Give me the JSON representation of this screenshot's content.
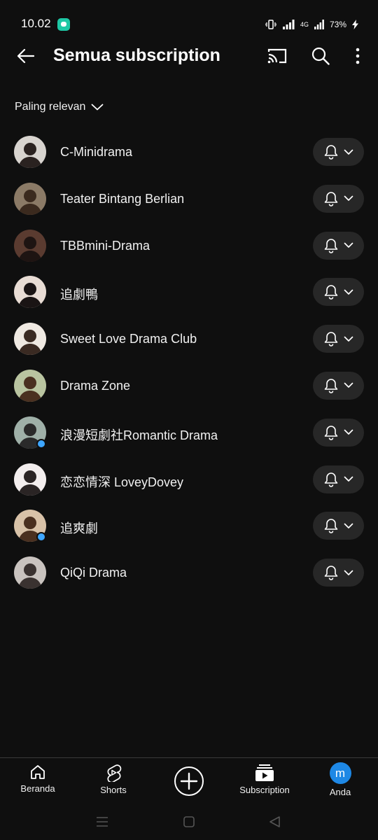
{
  "status_bar": {
    "time": "10.02",
    "network": "4G",
    "battery": "73%"
  },
  "header": {
    "title": "Semua subscription",
    "icons": [
      "back-arrow-icon",
      "cast-icon",
      "search-icon",
      "more-vert-icon"
    ]
  },
  "sort": {
    "label": "Paling relevan"
  },
  "channels": [
    {
      "name": "C-Minidrama",
      "has_new": false,
      "avatar_bg": "#d8d4cf",
      "avatar_fg": "#2a2220"
    },
    {
      "name": "Teater Bintang Berlian",
      "has_new": false,
      "avatar_bg": "#8b7a66",
      "avatar_fg": "#3b2a1e"
    },
    {
      "name": "TBBmini-Drama",
      "has_new": false,
      "avatar_bg": "#5a3b30",
      "avatar_fg": "#1e1412"
    },
    {
      "name": "追劇鴨",
      "has_new": false,
      "avatar_bg": "#e8dcd4",
      "avatar_fg": "#1a1414"
    },
    {
      "name": "Sweet Love Drama Club",
      "has_new": false,
      "avatar_bg": "#efe9e2",
      "avatar_fg": "#3a2a22"
    },
    {
      "name": "Drama Zone",
      "has_new": false,
      "avatar_bg": "#b9c4a0",
      "avatar_fg": "#4a3020"
    },
    {
      "name": "浪漫短劇社Romantic Drama",
      "has_new": true,
      "avatar_bg": "#9fb0a8",
      "avatar_fg": "#2a2a2a"
    },
    {
      "name": "恋恋情深 LoveyDovey",
      "has_new": false,
      "avatar_bg": "#f3eeee",
      "avatar_fg": "#2a2424"
    },
    {
      "name": "追爽劇",
      "has_new": true,
      "avatar_bg": "#d8c2a8",
      "avatar_fg": "#4a3020"
    },
    {
      "name": "QiQi Drama",
      "has_new": false,
      "avatar_bg": "#c9c3bf",
      "avatar_fg": "#3a3230"
    }
  ],
  "bottom_nav": {
    "home": "Beranda",
    "shorts": "Shorts",
    "subscriptions": "Subscription",
    "you": "Anda",
    "you_initial": "m"
  },
  "colors": {
    "background": "#0f0f0f",
    "pill": "#272727",
    "new_dot": "#3ea6ff",
    "you_avatar": "#1e88e5"
  }
}
